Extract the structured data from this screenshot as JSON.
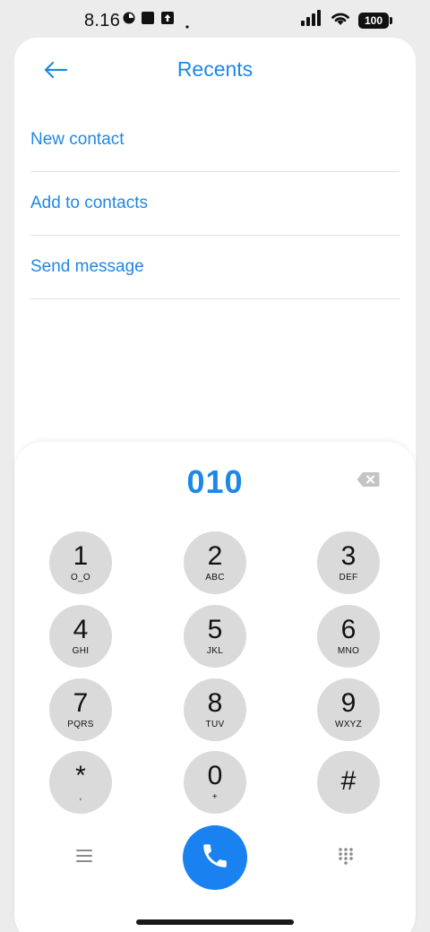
{
  "status_bar": {
    "time": "8.16",
    "battery": "100"
  },
  "header": {
    "back_icon": "arrow-left-icon",
    "title": "Recents"
  },
  "menu": {
    "items": [
      {
        "label": "New contact"
      },
      {
        "label": "Add to contacts"
      },
      {
        "label": "Send message"
      }
    ]
  },
  "dialer": {
    "number": "010",
    "backspace_icon": "backspace-icon",
    "keys": [
      {
        "digit": "1",
        "letters": "O_O"
      },
      {
        "digit": "2",
        "letters": "ABC"
      },
      {
        "digit": "3",
        "letters": "DEF"
      },
      {
        "digit": "4",
        "letters": "GHI"
      },
      {
        "digit": "5",
        "letters": "JKL"
      },
      {
        "digit": "6",
        "letters": "MNO"
      },
      {
        "digit": "7",
        "letters": "PQRS"
      },
      {
        "digit": "8",
        "letters": "TUV"
      },
      {
        "digit": "9",
        "letters": "WXYZ"
      },
      {
        "digit": "*",
        "letters": ","
      },
      {
        "digit": "0",
        "letters": "+"
      },
      {
        "digit": "#",
        "letters": ""
      }
    ],
    "menu_icon": "hamburger-icon",
    "call_icon": "phone-icon",
    "dialpad_icon": "dialpad-icon"
  },
  "colors": {
    "accent": "#1e88e5",
    "call_button": "#1a82f0",
    "key_background": "#dadada"
  }
}
